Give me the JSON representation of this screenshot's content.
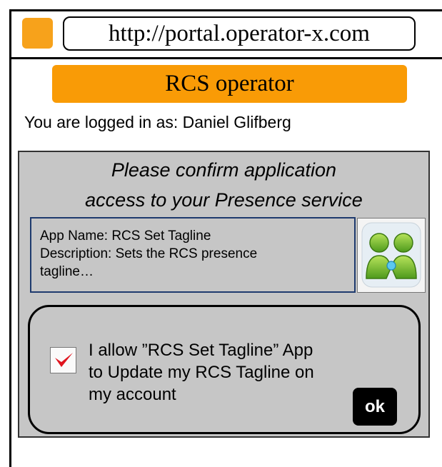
{
  "browser": {
    "url": "http://portal.operator-x.com",
    "logo_color": "#f7a21b"
  },
  "header": {
    "operator_name": "RCS operator",
    "bar_color": "#f99b06"
  },
  "session": {
    "logged_in_text": "You are logged in as: Daniel Glifberg"
  },
  "consent": {
    "title_line1": "Please confirm application",
    "title_line2": "access to your Presence service",
    "panel_color": "#c6c6c6",
    "app": {
      "name_line": "App Name: RCS Set Tagline",
      "description_line1": "Description: Sets the RCS presence",
      "description_line2": "tagline…",
      "icon": "presence-people-icon"
    },
    "permission": {
      "checked": true,
      "checkbox_icon": "checkmark-icon",
      "check_color": "#e0141e",
      "text_line1": "I allow ”RCS Set Tagline” App",
      "text_line2": "to Update my RCS Tagline on",
      "text_line3": "my account"
    },
    "ok_label": "ok"
  }
}
